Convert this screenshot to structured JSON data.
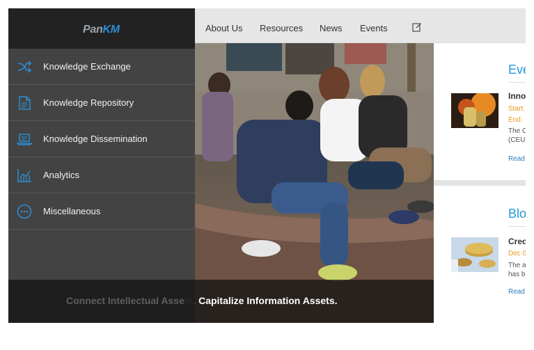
{
  "brand": {
    "part1": "Pan",
    "part2": "KM"
  },
  "topnav": {
    "items": [
      {
        "label": "About Us"
      },
      {
        "label": "Resources"
      },
      {
        "label": "News"
      },
      {
        "label": "Events"
      }
    ],
    "edit_icon": "edit-icon"
  },
  "sidebar": {
    "items": [
      {
        "label": "Knowledge Exchange",
        "icon": "shuffle-icon"
      },
      {
        "label": "Knowledge Repository",
        "icon": "document-icon"
      },
      {
        "label": "Knowledge Dissemination",
        "icon": "laptop-icon"
      },
      {
        "label": "Analytics",
        "icon": "chart-icon"
      },
      {
        "label": "Miscellaneous",
        "icon": "more-icon"
      }
    ]
  },
  "hero": {
    "caption_full": "Connect Intellectual Assets. Capitalize Information Assets.",
    "caption_visible": "ts. Capitalize Information Assets.",
    "caption_hidden": "Connect Intellectual Asse"
  },
  "events": {
    "title": "Eve",
    "item": {
      "title": "Inno",
      "start": "Start:",
      "end": "End:",
      "desc1": "The C",
      "desc2": "(CEU",
      "read": "Read"
    }
  },
  "blog": {
    "title": "Blo",
    "item": {
      "title": "Cred",
      "date": "Dec 0",
      "desc1": "The a",
      "desc2": "has b",
      "read": "Read"
    }
  },
  "colors": {
    "accent": "#1f9ad6",
    "meta": "#e49a1e",
    "drawer": "#282828"
  }
}
